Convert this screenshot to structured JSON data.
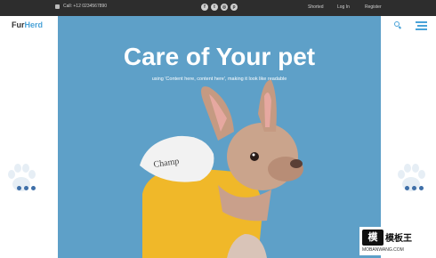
{
  "topbar": {
    "phone": "Call: +12 0234567890",
    "social_icons": [
      "facebook-icon",
      "twitter-icon",
      "instagram-icon",
      "pinterest-icon"
    ],
    "links": [
      "Shorted",
      "Log In",
      "Register"
    ]
  },
  "brand": {
    "name_a": "Fur",
    "name_b": "Herd",
    "accent": "#4aa3d8"
  },
  "hero": {
    "title": "Care of Your pet",
    "subtitle": "using 'Content here, content here', making it look like readable",
    "bg_color": "#5ea0c8",
    "image": "french-bulldog-in-yellow-hoodie"
  },
  "colors": {
    "topbar": "#2d2d2d",
    "paw": "#e6eef5",
    "dots": "#3f6fa8"
  },
  "watermark": {
    "badge": "模",
    "text": "模板王",
    "url": "MOBANWANG.COM"
  }
}
